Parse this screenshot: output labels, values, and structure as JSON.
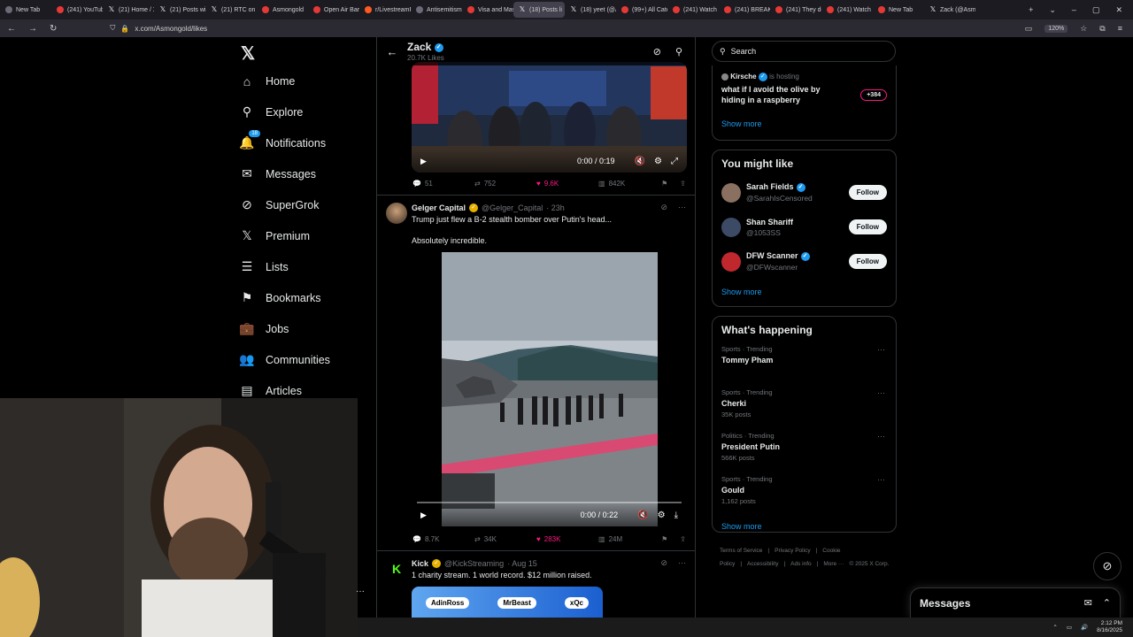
{
  "browser": {
    "tabs": [
      {
        "label": "New Tab",
        "fav": "nt"
      },
      {
        "label": "(241) YouTube",
        "fav": "yt"
      },
      {
        "label": "(21) Home / X",
        "fav": "x"
      },
      {
        "label": "(21) Posts wit",
        "fav": "x"
      },
      {
        "label": "(21) RTC on X",
        "fav": "x"
      },
      {
        "label": "Asmongold",
        "fav": "yt"
      },
      {
        "label": "Open Air Barb",
        "fav": "yt"
      },
      {
        "label": "r/LivestreamF",
        "fav": "rd"
      },
      {
        "label": "Antisemitism",
        "fav": "nt"
      },
      {
        "label": "Visa and Mast",
        "fav": "yt"
      },
      {
        "label": "(18) Posts li",
        "fav": "x",
        "active": true
      },
      {
        "label": "(18) yeet (@A",
        "fav": "x"
      },
      {
        "label": "(99+) All Cate",
        "fav": "yt"
      },
      {
        "label": "(241) Watch le",
        "fav": "yt"
      },
      {
        "label": "(241) BREAKIN",
        "fav": "yt"
      },
      {
        "label": "(241) They do",
        "fav": "yt"
      },
      {
        "label": "(241) Watch le",
        "fav": "yt"
      },
      {
        "label": "New Tab",
        "fav": "yt"
      },
      {
        "label": "Zack (@Asmo",
        "fav": "x"
      }
    ],
    "url": "x.com/Asmongold/likes",
    "zoom": "120%"
  },
  "sidebar": {
    "items": [
      {
        "label": "Home",
        "icon": "home-icon",
        "glyph": "⌂"
      },
      {
        "label": "Explore",
        "icon": "search-icon",
        "glyph": "⚲"
      },
      {
        "label": "Notifications",
        "icon": "bell-icon",
        "glyph": "🔔",
        "badge": "18"
      },
      {
        "label": "Messages",
        "icon": "envelope-icon",
        "glyph": "✉"
      },
      {
        "label": "SuperGrok",
        "icon": "grok-icon",
        "glyph": "⊘"
      },
      {
        "label": "Premium",
        "icon": "x-logo-icon",
        "glyph": "𝕏"
      },
      {
        "label": "Lists",
        "icon": "list-icon",
        "glyph": "☰"
      },
      {
        "label": "Bookmarks",
        "icon": "bookmark-icon",
        "glyph": "⚑"
      },
      {
        "label": "Jobs",
        "icon": "briefcase-icon",
        "glyph": "💼"
      },
      {
        "label": "Communities",
        "icon": "people-icon",
        "glyph": "👥"
      },
      {
        "label": "Articles",
        "icon": "article-icon",
        "glyph": "▤"
      }
    ]
  },
  "header": {
    "name": "Zack",
    "subtitle": "20.7K Likes"
  },
  "tweet1": {
    "video_time": "0:00 / 0:19",
    "replies": "51",
    "retweets": "752",
    "likes": "9.6K",
    "views": "842K"
  },
  "tweet2": {
    "name": "Gelger Capital",
    "handle": "@Gelger_Capital",
    "time": "· 23h",
    "line1": "Trump just flew a B-2 stealth bomber over Putin's head...",
    "line2": "Absolutely incredible.",
    "video_time": "0:00 / 0:22",
    "replies": "8.7K",
    "retweets": "34K",
    "likes": "283K",
    "views": "24M"
  },
  "tweet3": {
    "name": "Kick",
    "handle": "@KickStreaming",
    "time": "· Aug 15",
    "line1": "1 charity stream. 1 world record. $12 million raised.",
    "chips": [
      "AdinRoss",
      "MrBeast",
      "xQc"
    ]
  },
  "right": {
    "search_placeholder": "Search",
    "space_host": "Kirsche",
    "space_host_suffix": "is hosting",
    "space_title": "what if I avoid the olive by hiding in a raspberry",
    "space_count": "+384",
    "show_more": "Show more",
    "you_might_like": "You might like",
    "follows": [
      {
        "name": "Sarah Fields",
        "handle": "@SarahIsCensored",
        "verified": true
      },
      {
        "name": "Shan Shariff",
        "handle": "@1053SS",
        "verified": false
      },
      {
        "name": "DFW Scanner",
        "handle": "@DFWscanner",
        "verified": true
      }
    ],
    "follow_label": "Follow",
    "happening": "What's happening",
    "trends": [
      {
        "cat": "Sports · Trending",
        "title": "Tommy Pham",
        "count": ""
      },
      {
        "cat": "Sports · Trending",
        "title": "Cherki",
        "count": "35K posts"
      },
      {
        "cat": "Politics · Trending",
        "title": "President Putin",
        "count": "566K posts"
      },
      {
        "cat": "Sports · Trending",
        "title": "Gould",
        "count": "1,162 posts"
      }
    ],
    "footer": [
      "Terms of Service",
      "|",
      "Privacy Policy",
      "|",
      "Cookie Policy",
      "|",
      "Accessibility",
      "|",
      "Ads info",
      "|",
      "More ···",
      "© 2025 X Corp."
    ]
  },
  "dock": {
    "messages": "Messages"
  },
  "taskbar": {
    "time": "2:12 PM",
    "date": "8/16/2025"
  }
}
